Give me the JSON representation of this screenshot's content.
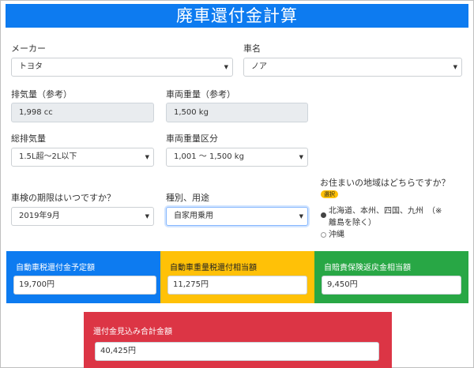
{
  "header": {
    "title": "廃車還付金計算"
  },
  "form": {
    "maker": {
      "label": "メーカー",
      "value": "トヨタ"
    },
    "model": {
      "label": "車名",
      "value": "ノア"
    },
    "displacement": {
      "label": "排気量（参考）",
      "value": "1,998 cc"
    },
    "weight": {
      "label": "車両重量（参考）",
      "value": "1,500 kg"
    },
    "total_displacement": {
      "label": "総排気量",
      "value": "1.5L超〜2L以下"
    },
    "weight_class": {
      "label": "車両重量区分",
      "value": "1,001 〜 1,500 kg"
    },
    "inspection": {
      "label": "車検の期限はいつですか？",
      "value": "2019年9月"
    },
    "usage": {
      "label": "種別、用途",
      "value": "自家用乗用"
    },
    "region": {
      "label": "お住まいの地域はどちらですか？",
      "badge": "選択",
      "options": [
        {
          "line1": "北海道、本州、四国、九州　（※",
          "line2": "離島を除く）",
          "selected": true
        },
        {
          "line1": "沖縄",
          "selected": false
        }
      ]
    }
  },
  "results": [
    {
      "label": "自動車税還付金予定額",
      "value": "19,700円",
      "color": "#0d7bf0"
    },
    {
      "label": "自動車重量税還付相当額",
      "value": "11,275円",
      "color": "#ffc107"
    },
    {
      "label": "自賠責保険返戻金相当額",
      "value": "9,450円",
      "color": "#28a745"
    }
  ],
  "total": {
    "label": "還付金見込み合計金額",
    "value": "40,425円",
    "color": "#dc3545"
  },
  "colors": {
    "primary": "#0d7bf0",
    "warning": "#ffc107",
    "success": "#28a745",
    "danger": "#dc3545"
  }
}
